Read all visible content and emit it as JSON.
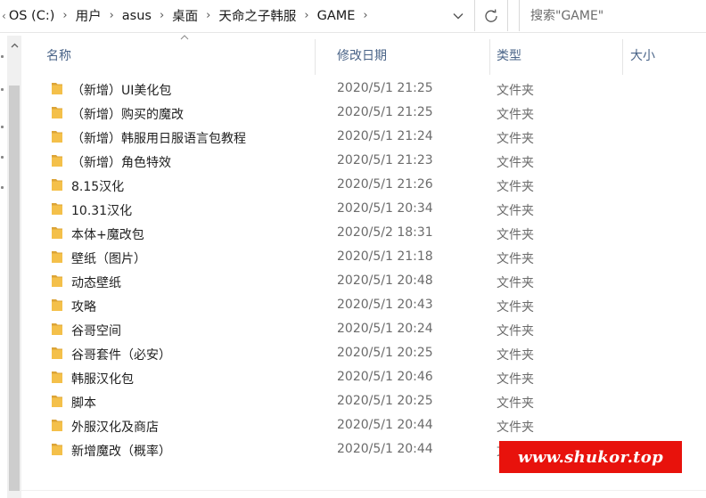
{
  "address_bar": {
    "crumbs": [
      "OS (C:)",
      "用户",
      "asus",
      "桌面",
      "天命之子韩服",
      "GAME"
    ],
    "lead_chevron": "‹",
    "separator": "›"
  },
  "search": {
    "placeholder": "搜索\"GAME\""
  },
  "columns": {
    "name": "名称",
    "date": "修改日期",
    "type": "类型",
    "size": "大小"
  },
  "files": [
    {
      "name": "（新增）UI美化包",
      "date": "2020/5/1 21:25",
      "type": "文件夹"
    },
    {
      "name": "（新增）购买的魔改",
      "date": "2020/5/1 21:25",
      "type": "文件夹"
    },
    {
      "name": "（新增）韩服用日服语言包教程",
      "date": "2020/5/1 21:24",
      "type": "文件夹"
    },
    {
      "name": "（新增）角色特效",
      "date": "2020/5/1 21:23",
      "type": "文件夹"
    },
    {
      "name": "8.15汉化",
      "date": "2020/5/1 21:26",
      "type": "文件夹"
    },
    {
      "name": "10.31汉化",
      "date": "2020/5/1 20:34",
      "type": "文件夹"
    },
    {
      "name": "本体+魔改包",
      "date": "2020/5/2 18:31",
      "type": "文件夹"
    },
    {
      "name": "壁纸（图片）",
      "date": "2020/5/1 21:18",
      "type": "文件夹"
    },
    {
      "name": "动态壁纸",
      "date": "2020/5/1 20:48",
      "type": "文件夹"
    },
    {
      "name": "攻略",
      "date": "2020/5/1 20:43",
      "type": "文件夹"
    },
    {
      "name": "谷哥空间",
      "date": "2020/5/1 20:24",
      "type": "文件夹"
    },
    {
      "name": "谷哥套件（必安）",
      "date": "2020/5/1 20:25",
      "type": "文件夹"
    },
    {
      "name": "韩服汉化包",
      "date": "2020/5/1 20:46",
      "type": "文件夹"
    },
    {
      "name": "脚本",
      "date": "2020/5/1 20:25",
      "type": "文件夹"
    },
    {
      "name": "外服汉化及商店",
      "date": "2020/5/1 20:44",
      "type": "文件夹"
    },
    {
      "name": "新增魔改（概率）",
      "date": "2020/5/1 20:44",
      "type": "文件夹"
    }
  ],
  "watermark": {
    "text": "www.shukor.top",
    "color": "#e8120c"
  },
  "colors": {
    "folder": "#f4c04a",
    "folder_dark": "#dca437",
    "header_text": "#4a6488"
  }
}
